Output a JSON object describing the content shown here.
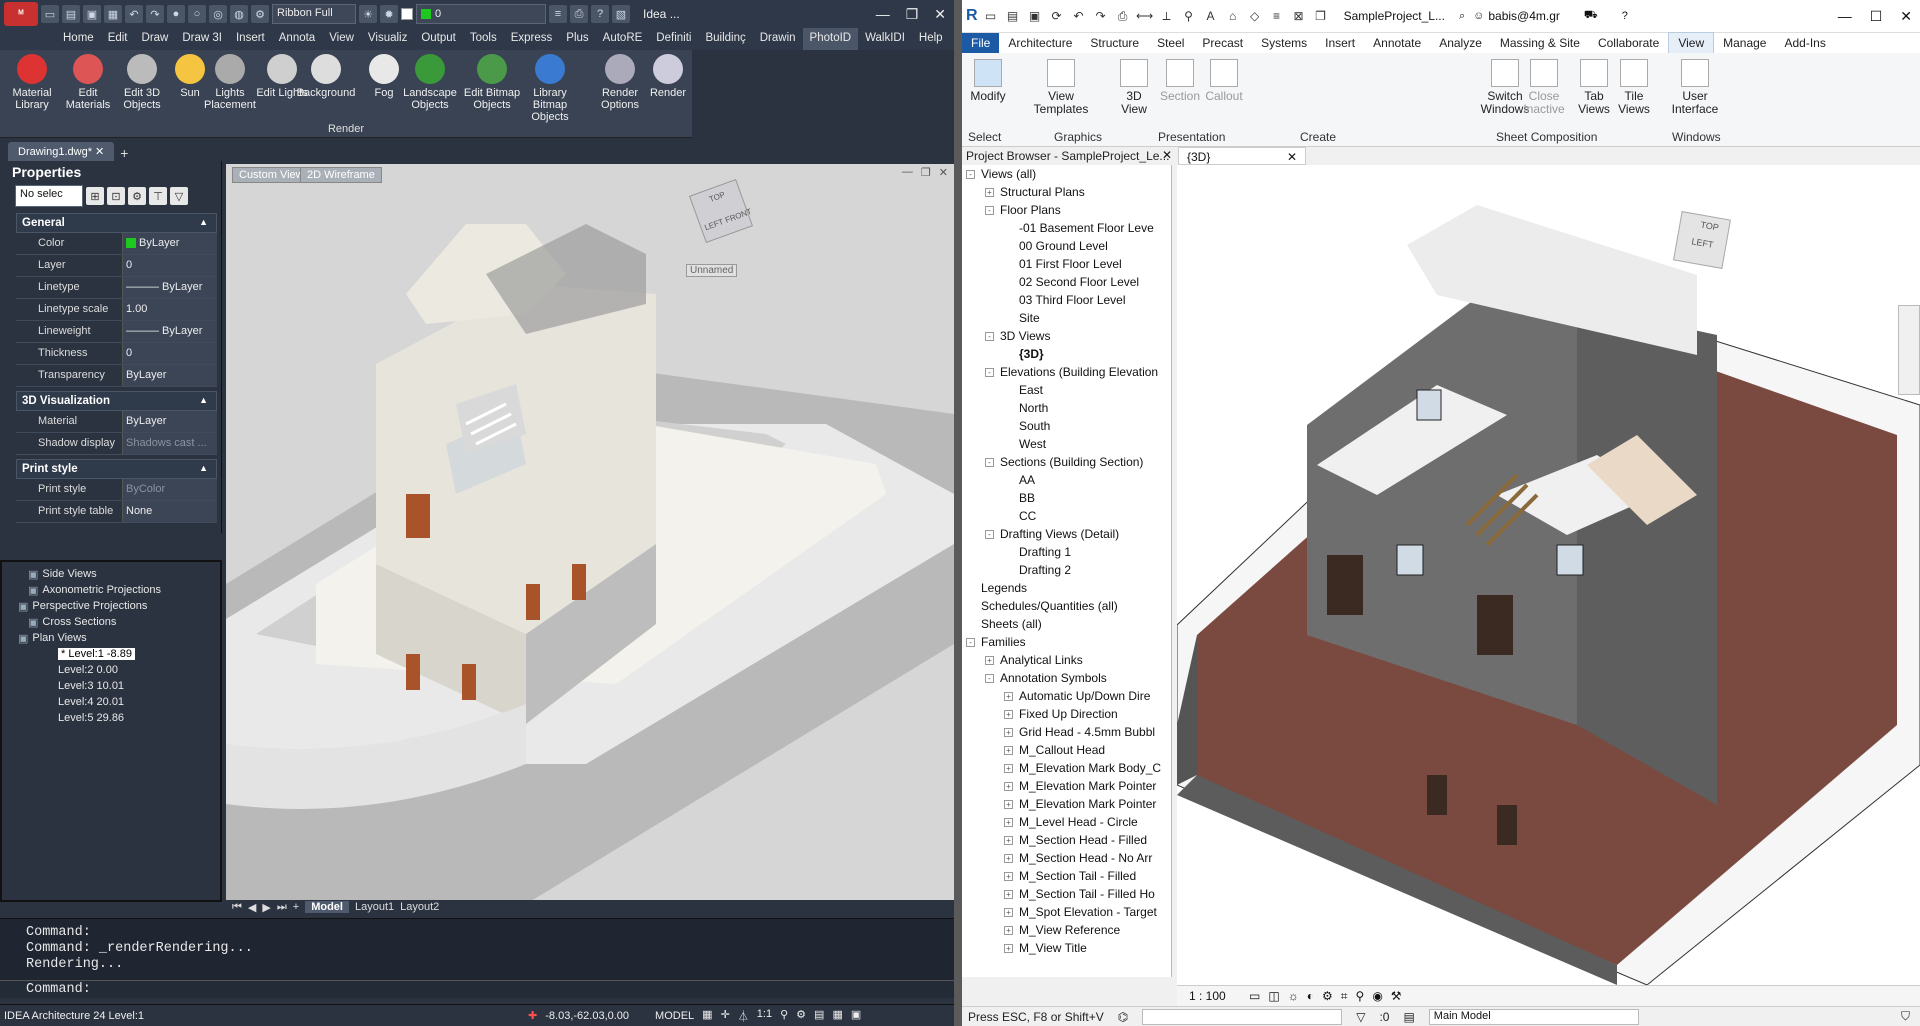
{
  "left": {
    "app_logo": "ᴹ",
    "title_text": "Idea ...",
    "ribbon_dropdown": "Ribbon Full",
    "layer_value": "0",
    "menu": [
      "Home",
      "Edit",
      "Draw",
      "Draw 3I",
      "Insert",
      "Annota",
      "View",
      "Visualiz",
      "Output",
      "Tools",
      "Express",
      "Plus",
      "AutoRE",
      "Definiti",
      "Buildinç",
      "Drawin",
      "PhotoID",
      "WalkIDI",
      "Help"
    ],
    "menu_active_index": 16,
    "ribbon_buttons": [
      "Material Library",
      "Edit Materials",
      "Edit 3D Objects",
      "Sun",
      "Lights Placement",
      "Edit Lights",
      "Background",
      "Fog",
      "Landscape Objects",
      "Edit Bitmap Objects",
      "Library Bitmap Objects",
      "Render Options",
      "Render"
    ],
    "ribbon_group": "Render",
    "doc_tab": "Drawing1.dwg*",
    "properties_title": "Properties",
    "no_selection": "No selec",
    "sections": [
      {
        "title": "General",
        "rows": [
          [
            "Color",
            "ByLayer"
          ],
          [
            "Layer",
            "0"
          ],
          [
            "Linetype",
            "——— ByLayer"
          ],
          [
            "Linetype scale",
            "1.00"
          ],
          [
            "Lineweight",
            "——— ByLayer"
          ],
          [
            "Thickness",
            "0"
          ],
          [
            "Transparency",
            "ByLayer"
          ]
        ]
      },
      {
        "title": "3D Visualization",
        "rows": [
          [
            "Material",
            "ByLayer"
          ],
          [
            "Shadow display",
            "Shadows cast ..."
          ]
        ]
      },
      {
        "title": "Print style",
        "rows": [
          [
            "Print style",
            "ByColor"
          ],
          [
            "Print style table",
            "None"
          ]
        ]
      }
    ],
    "tree": [
      "Side Views",
      "Axonometric Projections",
      "Perspective Projections",
      "Cross Sections",
      "Plan Views",
      "* Level:1  -8.89",
      "Level:2  0.00",
      "Level:3  10.01",
      "Level:4  20.01",
      "Level:5  29.86"
    ],
    "viewport_btns": [
      "Custom View",
      "2D Wireframe"
    ],
    "viewcube_label": "Unnamed",
    "cube_faces": {
      "top": "TOP",
      "left": "LEFT",
      "front": "FRONT"
    },
    "layout_tabs": [
      "Model",
      "Layout1",
      "Layout2"
    ],
    "cmd_lines": [
      "Command:",
      "Command: _renderRendering...",
      "Rendering..."
    ],
    "cmd_prompt": "Command:",
    "status_left": "IDEA Architecture 24 Level:1",
    "status_coords": "-8.03,-62.03,0.00",
    "status_model": "MODEL",
    "status_scale": "1:1",
    "colors": {
      "accent": "#c8312f",
      "panel": "#2b3340"
    }
  },
  "right": {
    "title_text": "SampleProject_L...",
    "user": "babis@4m.gr",
    "menu": [
      "File",
      "Architecture",
      "Structure",
      "Steel",
      "Precast",
      "Systems",
      "Insert",
      "Annotate",
      "Analyze",
      "Massing & Site",
      "Collaborate",
      "View",
      "Manage",
      "Add-Ins"
    ],
    "menu_active_index": 11,
    "ribbon_buttons": [
      "Modify",
      "View Templates",
      "3D View",
      "Section",
      "Callout",
      "Switch Windows",
      "Close Inactive",
      "Tab Views",
      "Tile Views",
      "User Interface"
    ],
    "groups": [
      "Select",
      "Graphics",
      "Presentation",
      "Create",
      "Sheet Composition",
      "Windows"
    ],
    "browser_title": "Project Browser - SampleProject_Le...",
    "view_tab": "{3D}",
    "browser": [
      {
        "t": "Views (all)",
        "l": 0,
        "e": "-"
      },
      {
        "t": "Structural Plans",
        "l": 1,
        "e": "+"
      },
      {
        "t": "Floor Plans",
        "l": 1,
        "e": "-"
      },
      {
        "t": "-01 Basement Floor Leve",
        "l": 2,
        "e": ""
      },
      {
        "t": "00 Ground Level",
        "l": 2,
        "e": ""
      },
      {
        "t": "01 First Floor Level",
        "l": 2,
        "e": ""
      },
      {
        "t": "02 Second Floor Level",
        "l": 2,
        "e": ""
      },
      {
        "t": "03 Third Floor Level",
        "l": 2,
        "e": ""
      },
      {
        "t": "Site",
        "l": 2,
        "e": ""
      },
      {
        "t": "3D Views",
        "l": 1,
        "e": "-"
      },
      {
        "t": "{3D}",
        "l": 2,
        "e": "",
        "b": true
      },
      {
        "t": "Elevations (Building Elevation",
        "l": 1,
        "e": "-"
      },
      {
        "t": "East",
        "l": 2,
        "e": ""
      },
      {
        "t": "North",
        "l": 2,
        "e": ""
      },
      {
        "t": "South",
        "l": 2,
        "e": ""
      },
      {
        "t": "West",
        "l": 2,
        "e": ""
      },
      {
        "t": "Sections (Building Section)",
        "l": 1,
        "e": "-"
      },
      {
        "t": "AA",
        "l": 2,
        "e": ""
      },
      {
        "t": "BB",
        "l": 2,
        "e": ""
      },
      {
        "t": "CC",
        "l": 2,
        "e": ""
      },
      {
        "t": "Drafting Views (Detail)",
        "l": 1,
        "e": "-"
      },
      {
        "t": "Drafting 1",
        "l": 2,
        "e": ""
      },
      {
        "t": "Drafting 2",
        "l": 2,
        "e": ""
      },
      {
        "t": "Legends",
        "l": 0,
        "e": ""
      },
      {
        "t": "Schedules/Quantities (all)",
        "l": 0,
        "e": ""
      },
      {
        "t": "Sheets (all)",
        "l": 0,
        "e": ""
      },
      {
        "t": "Families",
        "l": 0,
        "e": "-"
      },
      {
        "t": "Analytical Links",
        "l": 1,
        "e": "+"
      },
      {
        "t": "Annotation Symbols",
        "l": 1,
        "e": "-"
      },
      {
        "t": "Automatic Up/Down Dire",
        "l": 2,
        "e": "+"
      },
      {
        "t": "Fixed Up Direction",
        "l": 2,
        "e": "+"
      },
      {
        "t": "Grid Head - 4.5mm Bubbl",
        "l": 2,
        "e": "+"
      },
      {
        "t": "M_Callout Head",
        "l": 2,
        "e": "+"
      },
      {
        "t": "M_Elevation Mark Body_C",
        "l": 2,
        "e": "+"
      },
      {
        "t": "M_Elevation Mark Pointer",
        "l": 2,
        "e": "+"
      },
      {
        "t": "M_Elevation Mark Pointer",
        "l": 2,
        "e": "+"
      },
      {
        "t": "M_Level Head - Circle",
        "l": 2,
        "e": "+"
      },
      {
        "t": "M_Section Head - Filled",
        "l": 2,
        "e": "+"
      },
      {
        "t": "M_Section Head - No Arr",
        "l": 2,
        "e": "+"
      },
      {
        "t": "M_Section Tail - Filled",
        "l": 2,
        "e": "+"
      },
      {
        "t": "M_Section Tail - Filled Ho",
        "l": 2,
        "e": "+"
      },
      {
        "t": "M_Spot Elevation - Target",
        "l": 2,
        "e": "+"
      },
      {
        "t": "M_View Reference",
        "l": 2,
        "e": "+"
      },
      {
        "t": "M_View Title",
        "l": 2,
        "e": "+"
      }
    ],
    "scale": "1 : 100",
    "status_text": "Press ESC, F8 or Shift+V",
    "status_zero": ":0",
    "main_model": "Main Model",
    "cube_left": "LEFT",
    "cube_top": "TOP",
    "colors": {
      "file_tab": "#1d5aa6",
      "ground": "#7a4a40"
    }
  }
}
